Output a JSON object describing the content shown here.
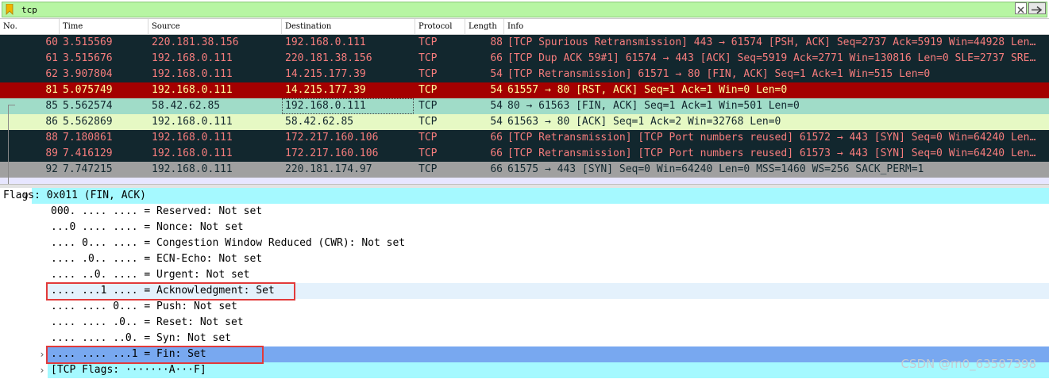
{
  "filter": {
    "value": "tcp"
  },
  "columns": [
    "No.",
    "Time",
    "Source",
    "Destination",
    "Protocol",
    "Length",
    "Info"
  ],
  "packets": [
    {
      "no": "60",
      "time": "3.515569",
      "src": "220.181.38.156",
      "dst": "192.168.0.111",
      "proto": "TCP",
      "len": "88",
      "info": "[TCP Spurious Retransmission] 443 → 61574 [PSH, ACK] Seq=2737 Ack=5919 Win=44928 Len…",
      "style": "dark"
    },
    {
      "no": "61",
      "time": "3.515676",
      "src": "192.168.0.111",
      "dst": "220.181.38.156",
      "proto": "TCP",
      "len": "66",
      "info": "[TCP Dup ACK 59#1] 61574 → 443 [ACK] Seq=5919 Ack=2771 Win=130816 Len=0 SLE=2737 SRE…",
      "style": "dark"
    },
    {
      "no": "62",
      "time": "3.907804",
      "src": "192.168.0.111",
      "dst": "14.215.177.39",
      "proto": "TCP",
      "len": "54",
      "info": "[TCP Retransmission] 61571 → 80 [FIN, ACK] Seq=1 Ack=1 Win=515 Len=0",
      "style": "dark"
    },
    {
      "no": "81",
      "time": "5.075749",
      "src": "192.168.0.111",
      "dst": "14.215.177.39",
      "proto": "TCP",
      "len": "54",
      "info": "61557 → 80 [RST, ACK] Seq=1 Ack=1 Win=0 Len=0",
      "style": "bad"
    },
    {
      "no": "85",
      "time": "5.562574",
      "src": "58.42.62.85",
      "dst": "192.168.0.111",
      "proto": "TCP",
      "len": "54",
      "info": "80 → 61563 [FIN, ACK] Seq=1 Ack=1 Win=501 Len=0",
      "style": "fin"
    },
    {
      "no": "86",
      "time": "5.562869",
      "src": "192.168.0.111",
      "dst": "58.42.62.85",
      "proto": "TCP",
      "len": "54",
      "info": "61563 → 80 [ACK] Seq=1 Ack=2 Win=32768 Len=0",
      "style": "ack2"
    },
    {
      "no": "88",
      "time": "7.180861",
      "src": "192.168.0.111",
      "dst": "172.217.160.106",
      "proto": "TCP",
      "len": "66",
      "info": "[TCP Retransmission] [TCP Port numbers reused] 61572 → 443 [SYN] Seq=0 Win=64240 Len…",
      "style": "dark"
    },
    {
      "no": "89",
      "time": "7.416129",
      "src": "192.168.0.111",
      "dst": "172.217.160.106",
      "proto": "TCP",
      "len": "66",
      "info": "[TCP Retransmission] [TCP Port numbers reused] 61573 → 443 [SYN] Seq=0 Win=64240 Len…",
      "style": "dark"
    },
    {
      "no": "92",
      "time": "7.747215",
      "src": "192.168.0.111",
      "dst": "220.181.174.97",
      "proto": "TCP",
      "len": "66",
      "info": "61575 → 443 [SYN] Seq=0 Win=64240 Len=0 MSS=1460 WS=256 SACK_PERM=1",
      "style": "syn"
    }
  ],
  "details": [
    {
      "text": "Flags: 0x011 (FIN, ACK)",
      "expander": "∨",
      "style": "hl-cyan"
    },
    {
      "text": "000. .... .... = Reserved: Not set"
    },
    {
      "text": "...0 .... .... = Nonce: Not set"
    },
    {
      "text": ".... 0... .... = Congestion Window Reduced (CWR): Not set"
    },
    {
      "text": ".... .0.. .... = ECN-Echo: Not set"
    },
    {
      "text": ".... ..0. .... = Urgent: Not set"
    },
    {
      "text": ".... ...1 .... = Acknowledgment: Set",
      "style": "hl-light"
    },
    {
      "text": ".... .... 0... = Push: Not set"
    },
    {
      "text": ".... .... .0.. = Reset: Not set"
    },
    {
      "text": ".... .... ..0. = Syn: Not set"
    },
    {
      "text": ".... .... ...1 = Fin: Set",
      "expander": "›",
      "style": "hl-blue"
    },
    {
      "text": "[TCP Flags: ·······A···F]",
      "expander": "›",
      "style": "hl-cyan"
    }
  ],
  "watermark": "CSDN @m0_63587398",
  "icons": {
    "bookmark": "bookmark-icon",
    "clear": "clear-icon",
    "apply": "arrow-right-icon"
  },
  "colors": {
    "filter_ok": "#b7f5a3",
    "dark_row": "#12272e",
    "dark_row_text": "#f77d7d",
    "bad_row": "#a40000",
    "highlight_box": "#e23a3a"
  }
}
